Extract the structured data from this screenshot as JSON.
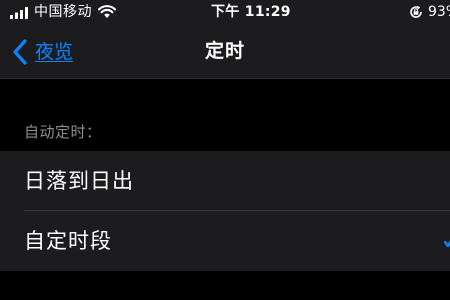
{
  "status_bar": {
    "carrier": "中国移动",
    "time": "下午 11:29",
    "battery": "93%",
    "icons": [
      "signal-icon",
      "wifi-icon",
      "rotation-lock-icon"
    ]
  },
  "nav": {
    "back_label": "夜览",
    "title": "定时",
    "accent_color": "#0a84ff"
  },
  "section": {
    "header": "自动定时：",
    "rows": [
      {
        "label": "日落到日出"
      },
      {
        "label": "自定时段"
      }
    ]
  },
  "colors": {
    "background": "#000000",
    "surface": "#1c1c1e",
    "secondary_text": "#8e8e93",
    "accent": "#0a84ff"
  }
}
